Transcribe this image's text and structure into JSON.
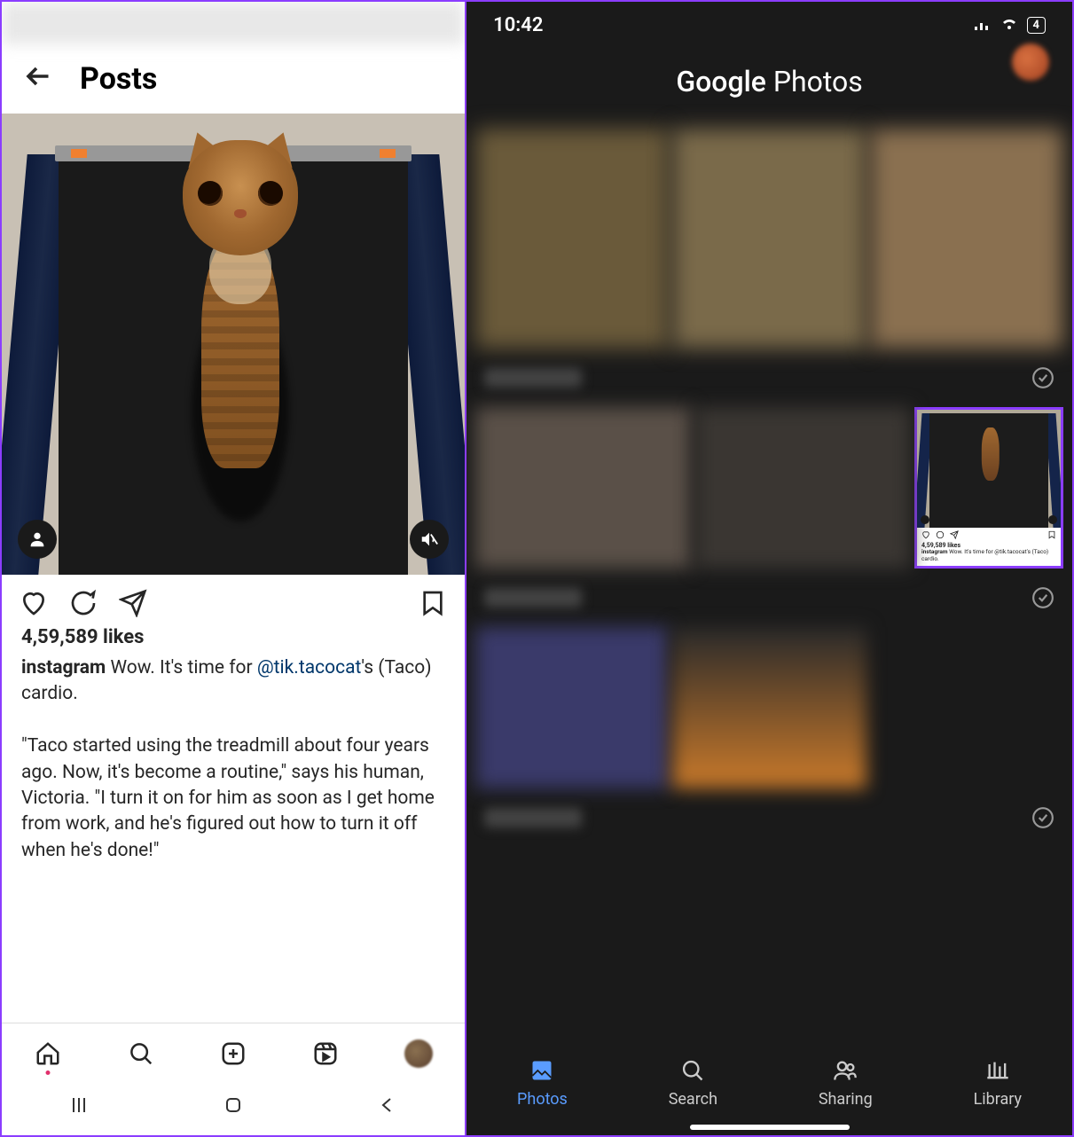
{
  "left": {
    "header": {
      "title": "Posts"
    },
    "post": {
      "likes": "4,59,589 likes",
      "username": "instagram",
      "caption_lead": " Wow. It's time for ",
      "mention": "@tik.tacocat",
      "caption_tail": "'s (Taco) cardio.",
      "caption_body": "\"Taco started using the treadmill about four years ago. Now, it's become a routine,\" says his human, Victoria. \"I turn it on for him as soon as I get home from work, and he's figured out how to turn it off when he's done!\""
    },
    "bottomnav": [
      "Home",
      "Search",
      "Create",
      "Reels",
      "Profile"
    ]
  },
  "right": {
    "status": {
      "time": "10:42",
      "battery": "4"
    },
    "header": {
      "title": "Google Photos"
    },
    "highlight": {
      "likes": "4,59,589 likes",
      "username": "instagram",
      "caption": " Wow. It's time for @tik.tacocat's (Taco) cardio."
    },
    "bottomnav": {
      "photos": "Photos",
      "search": "Search",
      "sharing": "Sharing",
      "library": "Library"
    }
  }
}
